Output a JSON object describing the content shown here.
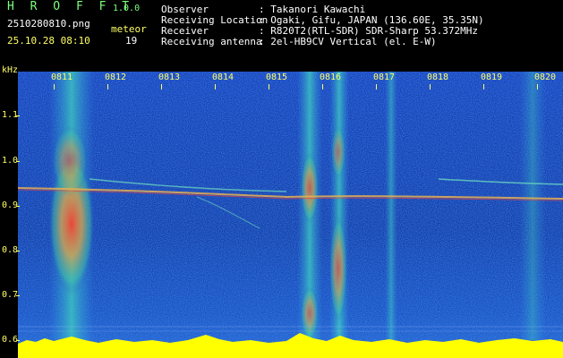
{
  "header": {
    "app_title": "H R O F F T",
    "version": "1.0.0",
    "filename": "2510280810.png",
    "datetime": "25.10.28 08:10",
    "meteor_label": "meteor",
    "meteor_count": "19",
    "observer_key": "Observer",
    "observer_value": ": Takanori Kawachi",
    "location_key": "Receiving Location",
    "location_value": ": Ogaki, Gifu, JAPAN (136.60E, 35.35N)",
    "receiver_key": "Receiver",
    "receiver_value": ": R820T2(RTL-SDR) SDR-Sharp 53.372MHz",
    "antenna_key": "Receiving antenna",
    "antenna_value": ": 2el-HB9CV Vertical (el. E-W)"
  },
  "axis": {
    "unit": "kHz",
    "y_ticks": [
      "1.1",
      "1.0",
      "0.9",
      "0.8",
      "0.7",
      "0.6"
    ],
    "x_ticks": [
      "0811",
      "0812",
      "0813",
      "0814",
      "0815",
      "0816",
      "0817",
      "0818",
      "0819",
      "0820"
    ]
  },
  "colors": {
    "background": "#000000",
    "header_white": "#ffffff",
    "header_yellow": "#ffff66",
    "header_green": "#7cff7c",
    "spectrogram_base": "#1530a8",
    "noise_floor": "#ffff00"
  }
}
